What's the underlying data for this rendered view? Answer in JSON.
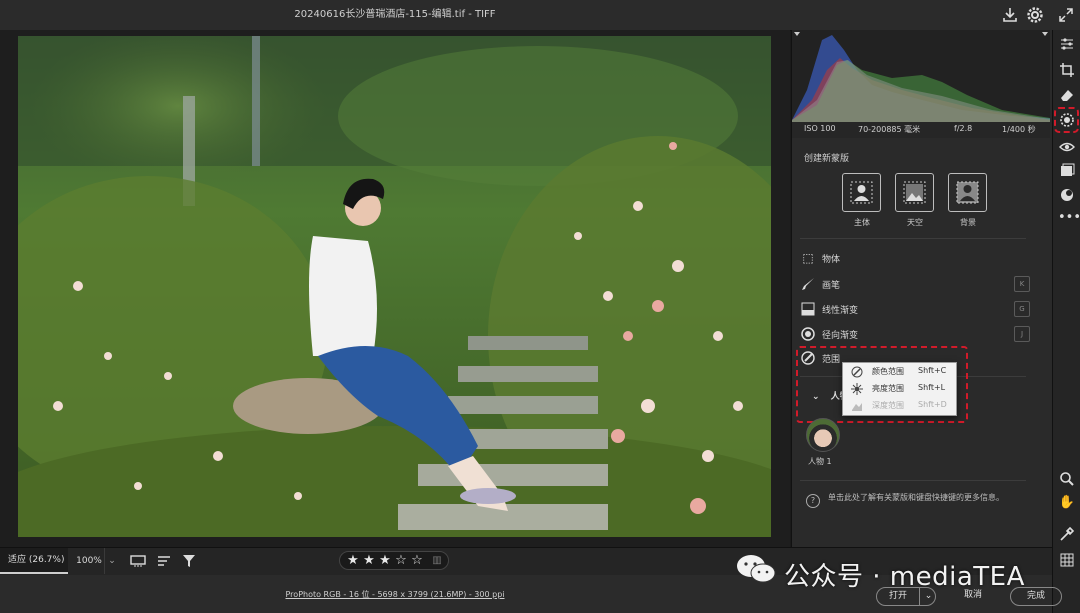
{
  "window": {
    "title": "20240616长沙普瑞酒店-115-编辑.tif -  TIFF"
  },
  "histogram": {
    "iso": "ISO 100",
    "lens": "70-200885 毫米",
    "aperture": "f/2.8",
    "shutter": "1/400 秒"
  },
  "mask_panel": {
    "section_title": "创建新蒙版",
    "quick_buttons": [
      {
        "label": "主体",
        "icon": "subject-icon"
      },
      {
        "label": "天空",
        "icon": "sky-icon"
      },
      {
        "label": "背景",
        "icon": "background-icon"
      }
    ],
    "tools": [
      {
        "label": "物体",
        "icon": "object-select-icon",
        "key": ""
      },
      {
        "label": "画笔",
        "icon": "brush-icon",
        "key": "K"
      },
      {
        "label": "线性渐变",
        "icon": "linear-gradient-icon",
        "key": "G"
      },
      {
        "label": "径向渐变",
        "icon": "radial-gradient-icon",
        "key": "J"
      },
      {
        "label": "范围",
        "icon": "range-icon",
        "key": ""
      }
    ],
    "range_menu": [
      {
        "label": "颜色范围",
        "shortcut": "Shft+C",
        "icon": "color-range-icon",
        "enabled": true
      },
      {
        "label": "亮度范围",
        "shortcut": "Shft+L",
        "icon": "luminance-range-icon",
        "enabled": true
      },
      {
        "label": "深度范围",
        "shortcut": "Shft+D",
        "icon": "depth-range-icon",
        "enabled": false
      }
    ],
    "people_header": "人物",
    "person_label": "人物 1",
    "help_text": "单击此处了解有关蒙版和键盘快捷键的更多信息。"
  },
  "bottom_toolbar": {
    "fit_label": "适应 (26.7%)",
    "zoom_label": "100%",
    "rating_stars": 3,
    "rating_max": 5
  },
  "status_bar": {
    "file_info": "ProPhoto RGB - 16 位 - 5698 x 3799 (21.6MP) - 300 ppi",
    "open_label": "打开",
    "cancel_label": "取消",
    "done_label": "完成"
  },
  "watermark": {
    "text": "公众号 · mediaTEA"
  },
  "colors": {
    "highlight_red": "#d11b2a",
    "panel_bg": "#2a2a2a"
  }
}
